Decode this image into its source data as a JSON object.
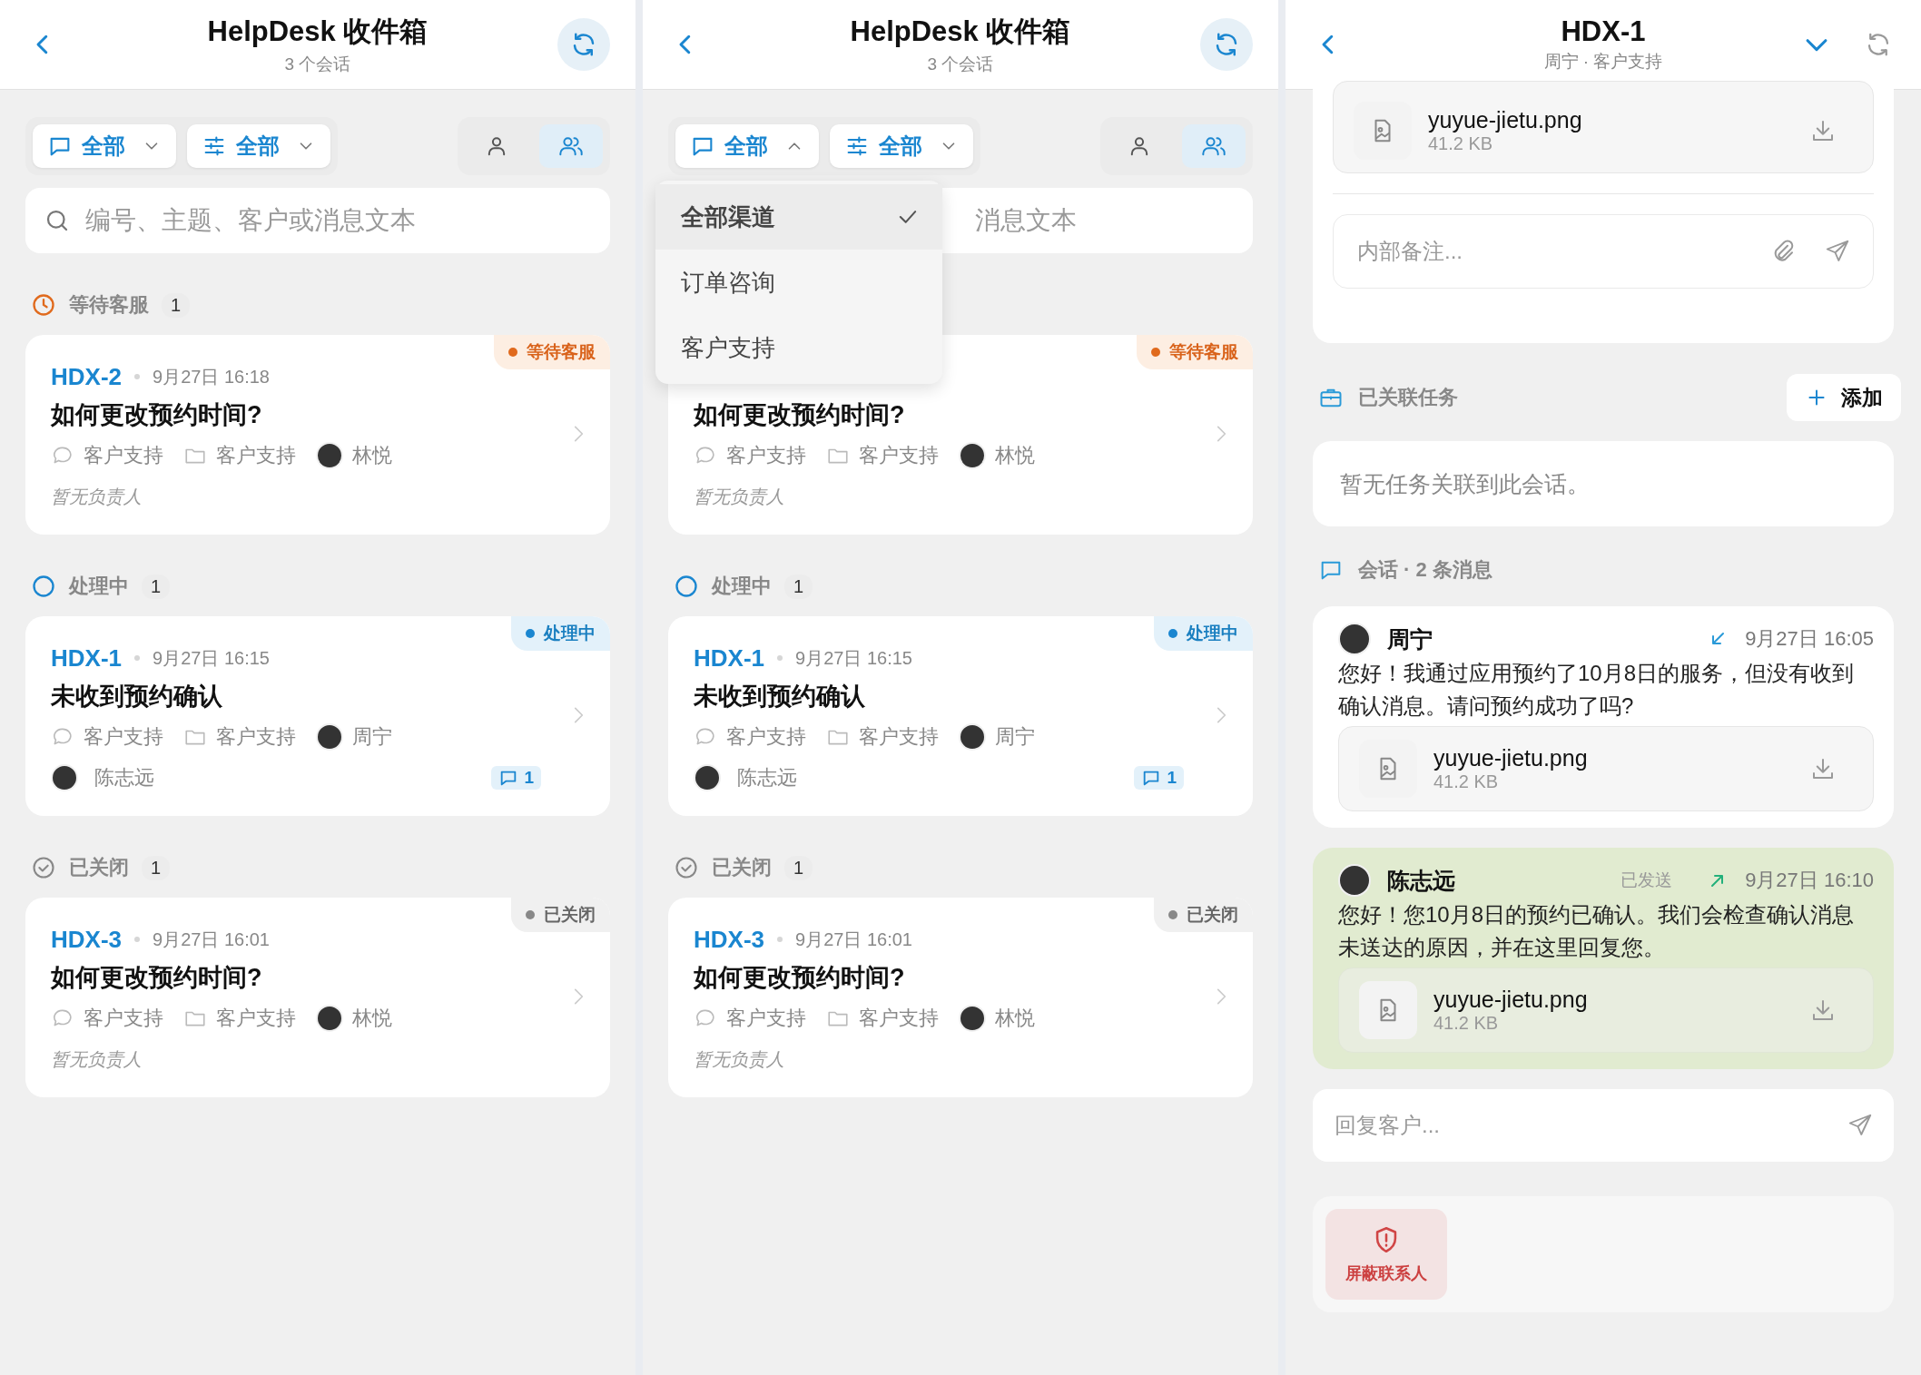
{
  "panels": [
    {
      "kind": "inbox",
      "header": {
        "title": "HelpDesk 收件箱",
        "subtitle": "3 个会话"
      },
      "filters": [
        {
          "kind": "channel",
          "label": "全部",
          "expanded": false
        },
        {
          "kind": "sliders",
          "label": "全部",
          "expanded": false
        }
      ],
      "view_toggle": [
        {
          "kind": "single",
          "selected": false
        },
        {
          "kind": "group",
          "selected": true
        }
      ],
      "search": {
        "placeholder": "编号、主题、客户或消息文本"
      },
      "groups": [
        {
          "kind": "waiting",
          "label": "等待客服",
          "count": "1",
          "tickets": [
            {
              "id": "HDX-2",
              "time": "9月27日 16:18",
              "subject": "如何更改预约时间?",
              "channel": "客户支持",
              "inbox": "客户支持",
              "customer": "林悦",
              "unassigned": "暂无负责人",
              "status": "等待客服"
            }
          ]
        },
        {
          "kind": "processing",
          "label": "处理中",
          "count": "1",
          "tickets": [
            {
              "id": "HDX-1",
              "time": "9月27日 16:15",
              "subject": "未收到预约确认",
              "channel": "客户支持",
              "inbox": "客户支持",
              "customer": "周宁",
              "assignee": "陈志远",
              "comments": "1",
              "status": "处理中"
            }
          ]
        },
        {
          "kind": "closed",
          "label": "已关闭",
          "count": "1",
          "tickets": [
            {
              "id": "HDX-3",
              "time": "9月27日 16:01",
              "subject": "如何更改预约时间?",
              "channel": "客户支持",
              "inbox": "客户支持",
              "customer": "林悦",
              "unassigned": "暂无负责人",
              "status": "已关闭"
            }
          ]
        }
      ]
    },
    {
      "kind": "inbox",
      "header": {
        "title": "HelpDesk 收件箱",
        "subtitle": "3 个会话"
      },
      "filters": [
        {
          "kind": "channel",
          "label": "全部",
          "expanded": true
        },
        {
          "kind": "sliders",
          "label": "全部",
          "expanded": false
        }
      ],
      "view_toggle": [
        {
          "kind": "single",
          "selected": false
        },
        {
          "kind": "group",
          "selected": true
        }
      ],
      "search": {
        "placeholder": "消息文本"
      },
      "dropdown": [
        {
          "label": "全部渠道",
          "selected": true
        },
        {
          "label": "订单咨询",
          "selected": false
        },
        {
          "label": "客户支持",
          "selected": false
        }
      ],
      "groups": [
        {
          "kind": "waiting",
          "tickets": [
            {
              "subject": "如何更改预约时间?",
              "channel": "客户支持",
              "inbox": "客户支持",
              "customer": "林悦",
              "unassigned": "暂无负责人",
              "status": "等待客服"
            }
          ]
        },
        {
          "kind": "processing",
          "label": "处理中",
          "count": "1",
          "tickets": [
            {
              "id": "HDX-1",
              "time": "9月27日 16:15",
              "subject": "未收到预约确认",
              "channel": "客户支持",
              "inbox": "客户支持",
              "customer": "周宁",
              "assignee": "陈志远",
              "comments": "1",
              "status": "处理中"
            }
          ]
        },
        {
          "kind": "closed",
          "label": "已关闭",
          "count": "1",
          "tickets": [
            {
              "id": "HDX-3",
              "time": "9月27日 16:01",
              "subject": "如何更改预约时间?",
              "channel": "客户支持",
              "inbox": "客户支持",
              "customer": "林悦",
              "unassigned": "暂无负责人",
              "status": "已关闭"
            }
          ]
        }
      ]
    },
    {
      "kind": "detail",
      "header": {
        "title": "HDX-1",
        "subtitle": "周宁 · 客户支持"
      },
      "top_attachment": {
        "name": "yuyue-jietu.png",
        "size": "41.2 KB"
      },
      "note": {
        "placeholder": "内部备注..."
      },
      "tasks": {
        "title": "已关联任务",
        "add_label": "添加",
        "empty": "暂无任务关联到此会话。"
      },
      "conversation": {
        "title": "会话 · 2 条消息",
        "messages": [
          {
            "kind": "incoming",
            "author": "周宁",
            "time": "9月27日 16:05",
            "text": "您好！我通过应用预约了10月8日的服务，但没有收到确认消息。请问预约成功了吗?",
            "attachment": {
              "name": "yuyue-jietu.png",
              "size": "41.2 KB"
            }
          },
          {
            "kind": "outgoing",
            "author": "陈志远",
            "status": "已发送",
            "time": "9月27日 16:10",
            "text": "您好！您10月8日的预约已确认。我们会检查确认消息未送达的原因，并在这里回复您。",
            "attachment": {
              "name": "yuyue-jietu.png",
              "size": "41.2 KB"
            }
          }
        ]
      },
      "reply": {
        "placeholder": "回复客户..."
      },
      "actions": [
        {
          "kind": "danger",
          "label": "屏蔽联系人"
        }
      ]
    }
  ]
}
